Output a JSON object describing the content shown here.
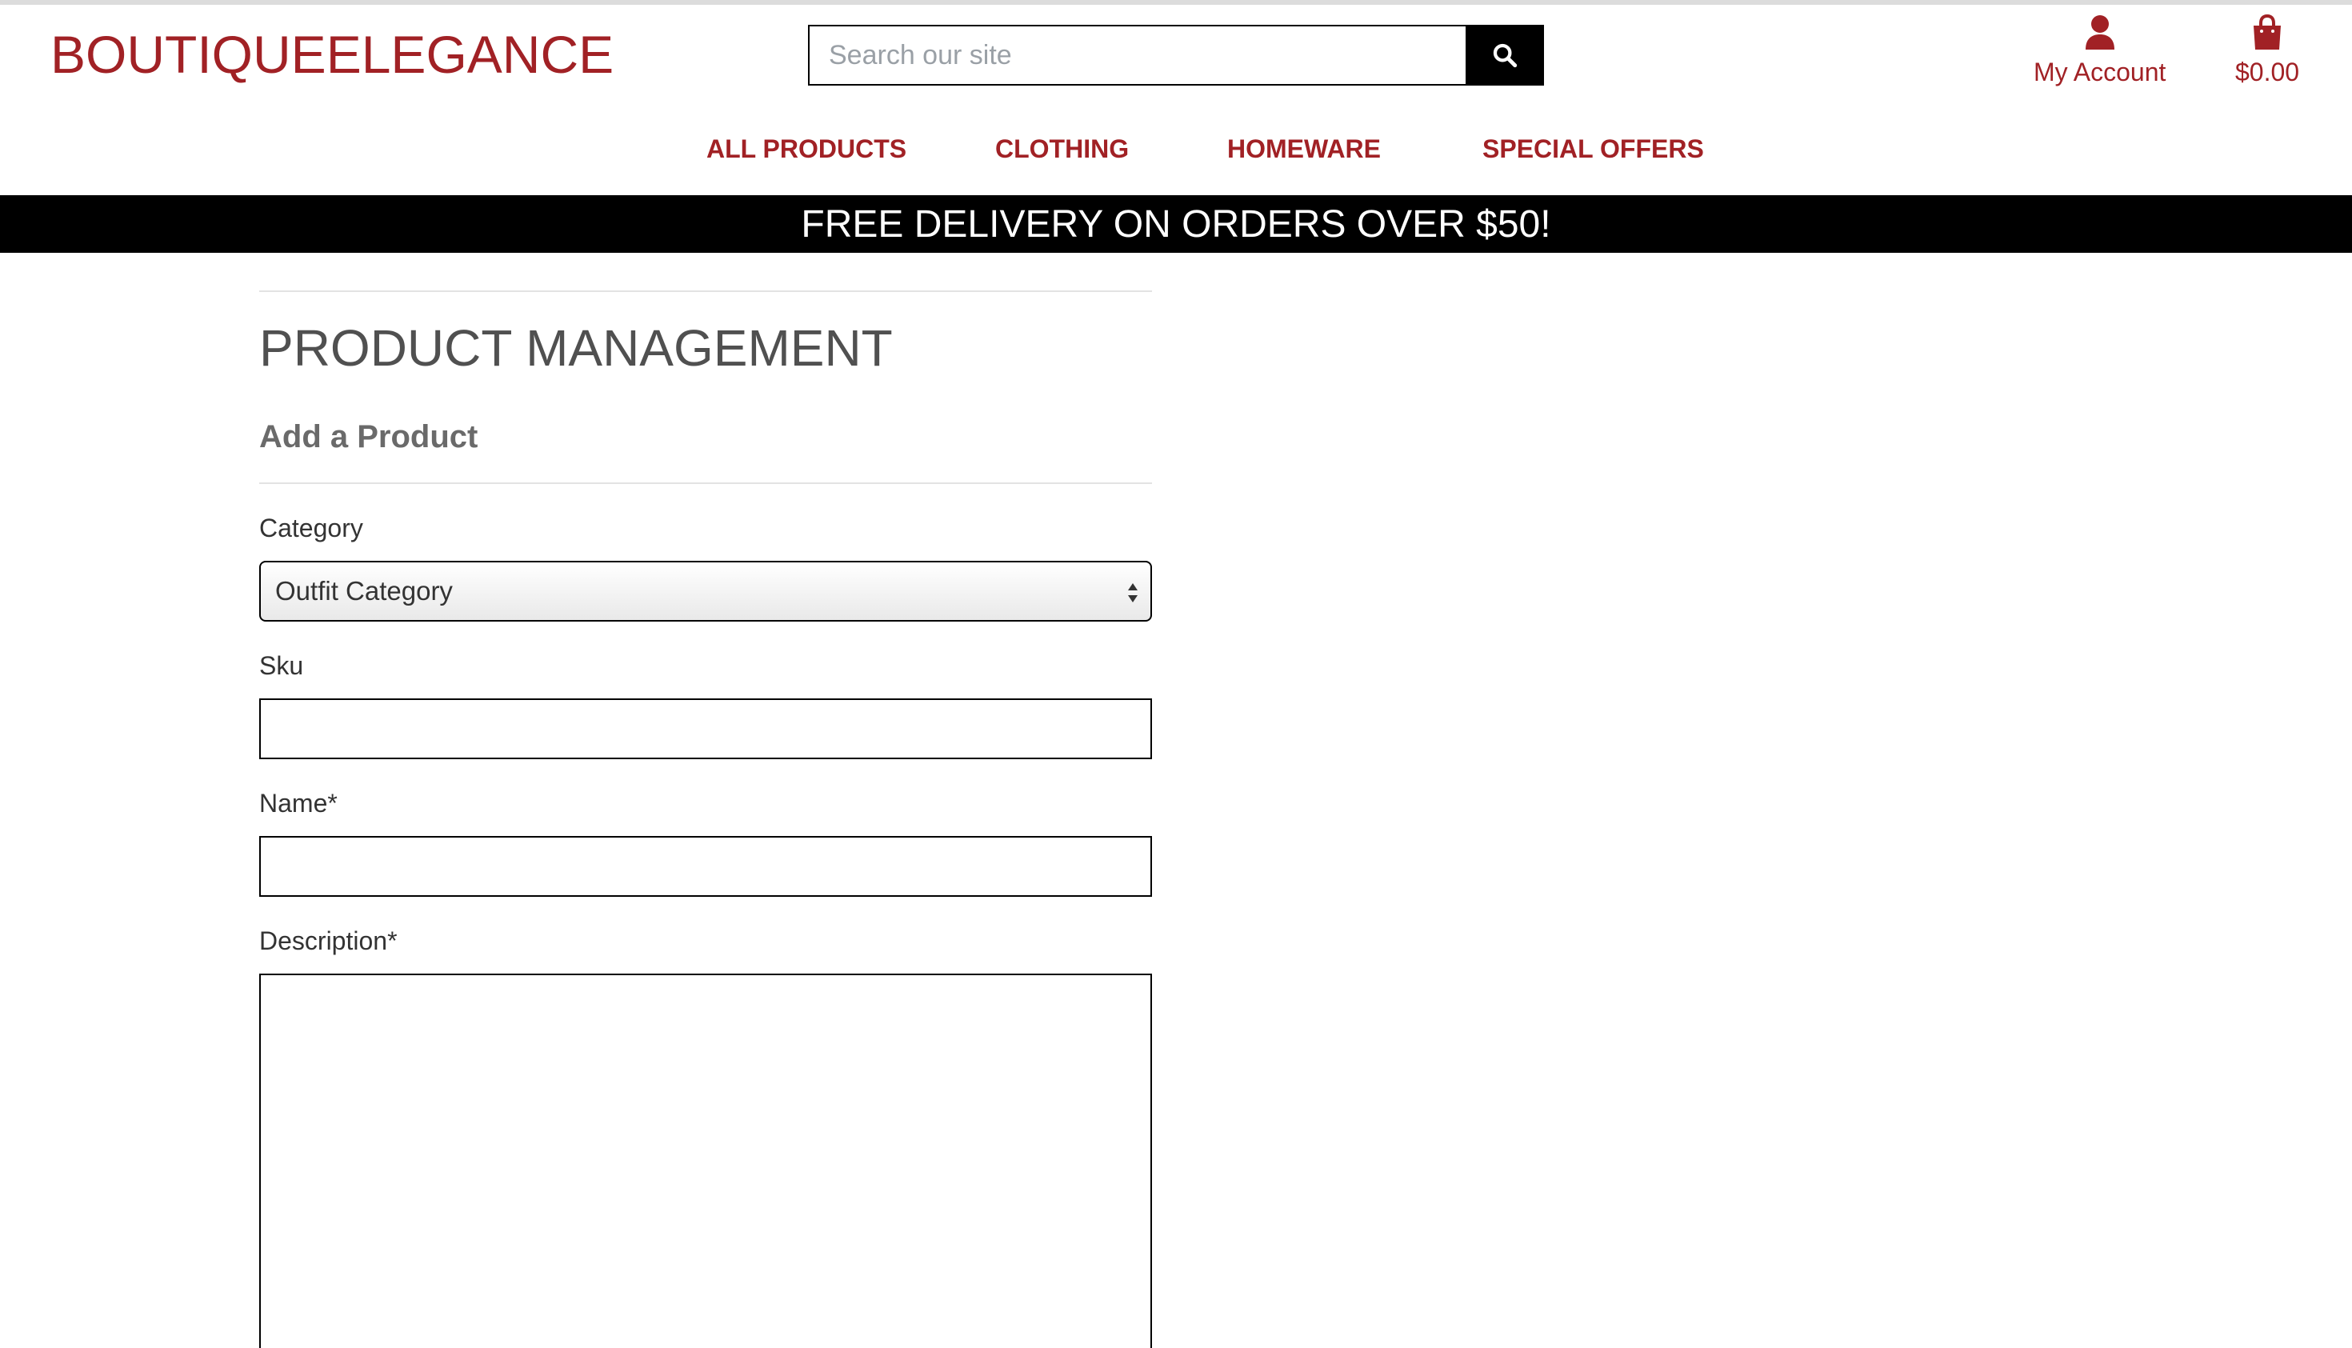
{
  "brand": {
    "logo_text": "BOUTIQUEELEGANCE",
    "accent_color": "#a12125"
  },
  "search": {
    "placeholder": "Search our site",
    "button_icon": "search-icon"
  },
  "header": {
    "account_label": "My Account",
    "account_icon": "user-icon",
    "bag_total": "$0.00",
    "bag_icon": "shopping-bag-icon"
  },
  "nav": {
    "items": [
      {
        "label": "ALL PRODUCTS"
      },
      {
        "label": "CLOTHING"
      },
      {
        "label": "HOMEWARE"
      },
      {
        "label": "SPECIAL OFFERS"
      }
    ]
  },
  "banner": {
    "text": "FREE DELIVERY ON ORDERS OVER $50!"
  },
  "main": {
    "title": "PRODUCT MANAGEMENT",
    "subtitle": "Add a Product",
    "form": {
      "category_label": "Category",
      "category_selected": "Outfit Category",
      "sku_label": "Sku",
      "sku_value": "",
      "name_label": "Name*",
      "name_value": "",
      "description_label": "Description*",
      "description_value": ""
    }
  }
}
